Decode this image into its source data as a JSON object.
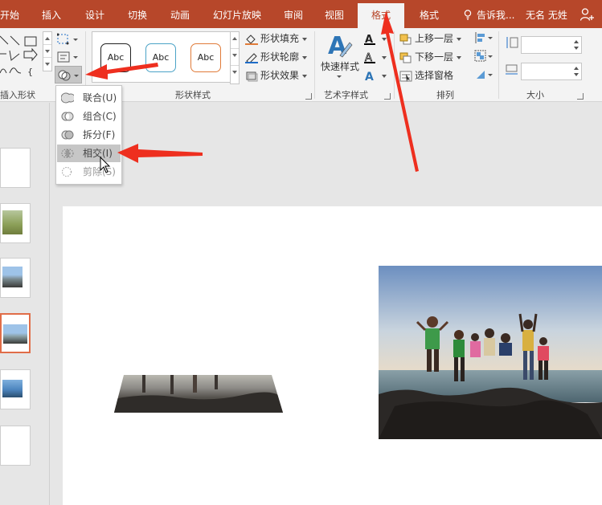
{
  "ribbon_tabs": [
    {
      "label": "开始"
    },
    {
      "label": "插入"
    },
    {
      "label": "设计"
    },
    {
      "label": "切换"
    },
    {
      "label": "动画"
    },
    {
      "label": "幻灯片放映"
    },
    {
      "label": "审阅"
    },
    {
      "label": "视图"
    },
    {
      "label": "格式",
      "active": true
    },
    {
      "label": "格式"
    }
  ],
  "tell_me": "告诉我...",
  "user_name": "无名 无姓",
  "groups": {
    "insert_shapes": "插入形状",
    "shape_styles": "形状样式",
    "wordart": "艺术字样式",
    "arrange": "排列",
    "size": "大小"
  },
  "shape_style_preview": [
    "Abc",
    "Abc",
    "Abc"
  ],
  "shape_commands": {
    "fill": "形状填充",
    "outline": "形状轮廓",
    "effects": "形状效果"
  },
  "wordart_quick": "快速样式",
  "arrange_commands": {
    "forward": "上移一层",
    "backward": "下移一层",
    "pane": "选择窗格"
  },
  "merge_menu": [
    {
      "label": "联合(U)"
    },
    {
      "label": "组合(C)"
    },
    {
      "label": "拆分(F)"
    },
    {
      "label": "相交(I)",
      "highlighted": true
    },
    {
      "label": "剪除(S)"
    }
  ],
  "colors": {
    "accent": "#b7472a",
    "arrow": "#ee2f1f",
    "selected_thumb": "#e06d48"
  }
}
